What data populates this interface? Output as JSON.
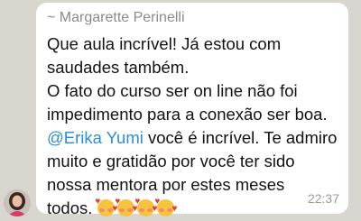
{
  "message": {
    "sender": "~ Margarette Perinelli",
    "lines": [
      "Que aula incrível! Já estou com",
      "saudades também.",
      "O fato do curso ser on line não foi",
      "impedimento para a conexão ser boa."
    ],
    "mention": "@Erika Yumi",
    "mention_tail": " você é incrível. Te admiro",
    "line6": "muito e gratidão por você ter sido",
    "line7": "nossa mentora por estes meses",
    "line8": "todos.",
    "time": "22:37"
  },
  "icons": {
    "emoji": "smiling-face-with-hearts-icon",
    "avatar": "avatar"
  },
  "colors": {
    "background": "#d9d5cf",
    "bubble": "#ffffff",
    "mention": "#2a8fd6",
    "sender": "#8a8a8a"
  }
}
